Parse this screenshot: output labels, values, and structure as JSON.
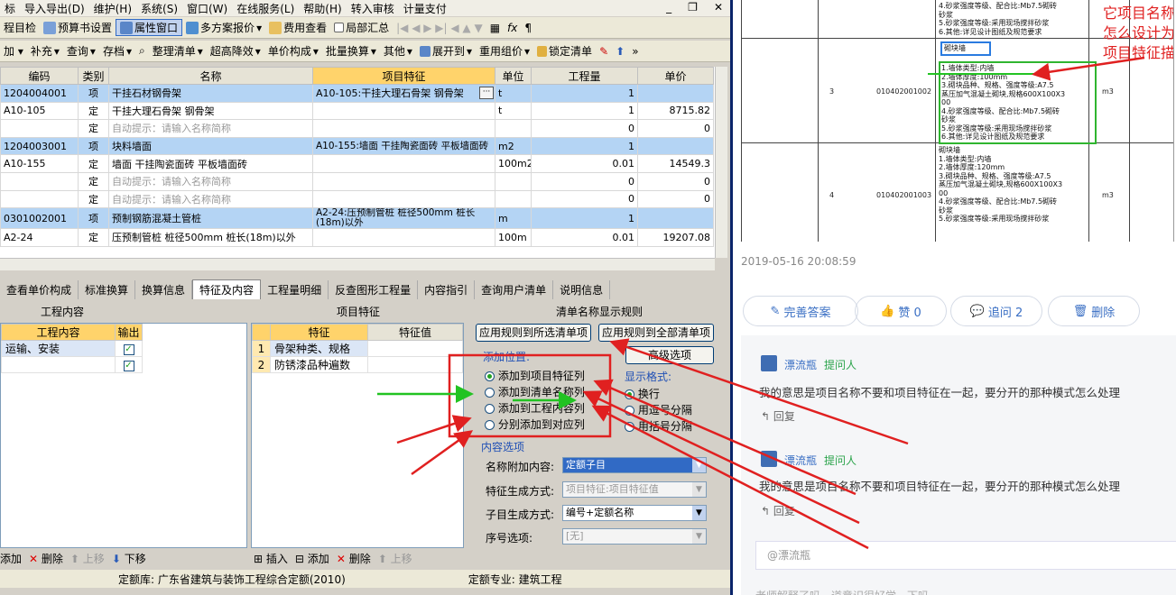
{
  "menu": [
    "标",
    "导入导出(D)",
    "维护(H)",
    "系统(S)",
    "窗口(W)",
    "在线服务(L)",
    "帮助(H)",
    "转入审核",
    "计量支付"
  ],
  "toolbar1": [
    "程目检",
    "预算书设置",
    "属性窗口",
    "多方案报价",
    "费用查看",
    "局部汇总"
  ],
  "toolbar2": [
    "补充",
    "查询",
    "存档",
    "整理清单",
    "超高降效",
    "单价构成",
    "批量换算",
    "其他",
    "展开到",
    "重用组价",
    "锁定清单"
  ],
  "grid": {
    "headers": [
      "编码",
      "类别",
      "名称",
      "项目特征",
      "单位",
      "工程量",
      "单价"
    ],
    "rows": [
      [
        "1204004001",
        "项",
        "干挂石材钢骨架",
        "A10-105:干挂大理石骨架 钢骨架",
        "t",
        "1",
        ""
      ],
      [
        "A10-105",
        "定",
        "干挂大理石骨架 钢骨架",
        "",
        "t",
        "1",
        "8715.82"
      ],
      [
        "",
        "定",
        "自动提示：请输入名称简称",
        "",
        "",
        "0",
        "0"
      ],
      [
        "1204003001",
        "项",
        "块料墙面",
        "A10-155:墙面 干挂陶瓷面砖 平板墙面砖",
        "m2",
        "1",
        ""
      ],
      [
        "A10-155",
        "定",
        "墙面 干挂陶瓷面砖 平板墙面砖",
        "",
        "100m2",
        "0.01",
        "14549.3"
      ],
      [
        "",
        "定",
        "自动提示：请输入名称简称",
        "",
        "",
        "0",
        "0"
      ],
      [
        "",
        "定",
        "自动提示：请输入名称简称",
        "",
        "",
        "0",
        "0"
      ],
      [
        "0301002001",
        "项",
        "预制钢筋混凝土管桩",
        "A2-24:压预制管桩 桩径500mm 桩长(18m)以外",
        "m",
        "1",
        ""
      ],
      [
        "A2-24",
        "定",
        "压预制管桩 桩径500mm 桩长(18m)以外",
        "",
        "100m",
        "0.01",
        "19207.08"
      ]
    ]
  },
  "tabs": [
    "查看单价构成",
    "标准换算",
    "换算信息",
    "特征及内容",
    "工程量明细",
    "反查图形工程量",
    "内容指引",
    "查询用户清单",
    "说明信息"
  ],
  "work_panel": {
    "title": "工程内容",
    "headers": [
      "工程内容",
      "输出"
    ],
    "rows": [
      [
        "运输、安装",
        "✓"
      ],
      [
        "",
        "✓"
      ]
    ]
  },
  "feature_panel": {
    "title": "项目特征",
    "headers": [
      "",
      "特征",
      "特征值"
    ],
    "rows": [
      [
        "1",
        "骨架种类、规格",
        ""
      ],
      [
        "2",
        "防锈漆品种遍数",
        ""
      ]
    ]
  },
  "rules": {
    "title": "清单名称显示规则",
    "btn_selected": "应用规则到所选清单项",
    "btn_all": "应用规则到全部清单项",
    "btn_advanced": "高级选项",
    "add_pos_title": "添加位置:",
    "add_pos": [
      "添加到项目特征列",
      "添加到清单名称列",
      "添加到工程内容列",
      "分别添加到对应列"
    ],
    "format_title": "显示格式:",
    "formats": [
      "换行",
      "用逗号分隔",
      "用括号分隔"
    ],
    "content_title": "内容选项",
    "name_append_label": "名称附加内容:",
    "name_append_value": "定额子目",
    "feature_gen_label": "特征生成方式:",
    "feature_gen_value": "项目特征:项目特征值",
    "sub_gen_label": "子目生成方式:",
    "sub_gen_value": "编号+定额名称",
    "seq_label": "序号选项:",
    "seq_value": "[无]"
  },
  "bottom_left": [
    "添加",
    "删除",
    "上移",
    "下移"
  ],
  "bottom_mid": [
    "插入",
    "添加",
    "删除",
    "上移"
  ],
  "status": {
    "left": "定额库: 广东省建筑与装饰工程综合定额(2010)",
    "right": "定额专业: 建筑工程"
  },
  "doc": {
    "rows": [
      {
        "no": "3",
        "code": "010402001002",
        "unit": "m3",
        "label": "砌块墙",
        "lines": [
          "1.墙体类型:内墙",
          "2.墙体厚度:100mm",
          "3.砌块品种、规格、强度等级:A7.5",
          "蒸压加气混凝土砌块,规格600X100X3",
          "00",
          "4.砂浆强度等级、配合比:Mb7.5砌砖",
          "砂浆",
          "5.砂浆强度等级:采用现场搅拌砂浆",
          "6.其他:详见设计图纸及规范要求"
        ]
      },
      {
        "no": "4",
        "code": "010402001003",
        "unit": "m3",
        "label": "砌块墙",
        "lines": [
          "1.墙体类型:内墙",
          "2.墙体厚度:120mm",
          "3.砌块品种、规格、强度等级:A7.5",
          "蒸压加气混凝土砌块,规格600X100X3",
          "00",
          "4.砂浆强度等级、配合比:Mb7.5砌砖",
          "砂浆",
          "5.砂浆强度等级:采用现场搅拌砂浆"
        ]
      }
    ],
    "top_lines": [
      "4.砂浆强度等级、配合比:Mb7.5砌砖",
      "砂浆",
      "5.砂浆强度等级:采用现场搅拌砂浆",
      "6.其他:详见设计图纸及规范要求"
    ],
    "annotation": [
      "它项目名称",
      "怎么设计为",
      "项目特征描"
    ]
  },
  "post": {
    "timestamp": "2019-05-16 20:08:59",
    "actions": [
      "完善答案",
      "赞 0",
      "追问 2",
      "删除"
    ],
    "comments": [
      {
        "user": "漂流瓶",
        "tag": "提问人",
        "text": "我的意思是项目名称不要和项目特征在一起，要分开的那种模式怎么处理",
        "reply": "回复"
      },
      {
        "user": "漂流瓶",
        "tag": "提问人",
        "text": "我的意思是项目名称不要和项目特征在一起，要分开的那种模式怎么处理",
        "reply": "回复"
      }
    ],
    "input_placeholder": "@漂流瓶",
    "footer_hint": "老师解释了吗，道意识很好学，下吗"
  }
}
